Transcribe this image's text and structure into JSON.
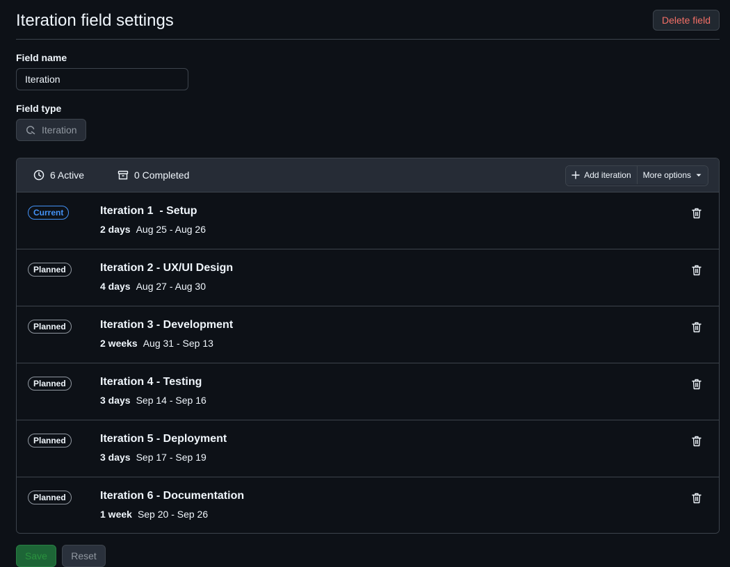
{
  "page": {
    "title": "Iteration field settings",
    "delete_label": "Delete field"
  },
  "field": {
    "name_label": "Field name",
    "name_value": "Iteration",
    "type_label": "Field type",
    "type_value": "Iteration"
  },
  "panel": {
    "active_label": "6 Active",
    "completed_label": "0 Completed",
    "add_label": "Add iteration",
    "more_label": "More options",
    "iterations": [
      {
        "status": "Current",
        "title": "Iteration 1  - Setup",
        "duration": "2 days",
        "dates": "Aug 25 - Aug 26"
      },
      {
        "status": "Planned",
        "title": "Iteration 2 - UX/UI Design",
        "duration": "4 days",
        "dates": "Aug 27 - Aug 30"
      },
      {
        "status": "Planned",
        "title": "Iteration 3 - Development",
        "duration": "2 weeks",
        "dates": "Aug 31 - Sep 13"
      },
      {
        "status": "Planned",
        "title": "Iteration 4 - Testing",
        "duration": "3 days",
        "dates": "Sep 14 - Sep 16"
      },
      {
        "status": "Planned",
        "title": "Iteration 5 - Deployment",
        "duration": "3 days",
        "dates": "Sep 17 - Sep 19"
      },
      {
        "status": "Planned",
        "title": "Iteration 6 - Documentation",
        "duration": "1 week",
        "dates": "Sep 20 - Sep 26"
      }
    ]
  },
  "footer": {
    "save_label": "Save",
    "reset_label": "Reset"
  },
  "colors": {
    "background": "#0d1117",
    "accent_current": "#4493f8",
    "danger": "#f47067",
    "save_green": "#2ea043"
  }
}
